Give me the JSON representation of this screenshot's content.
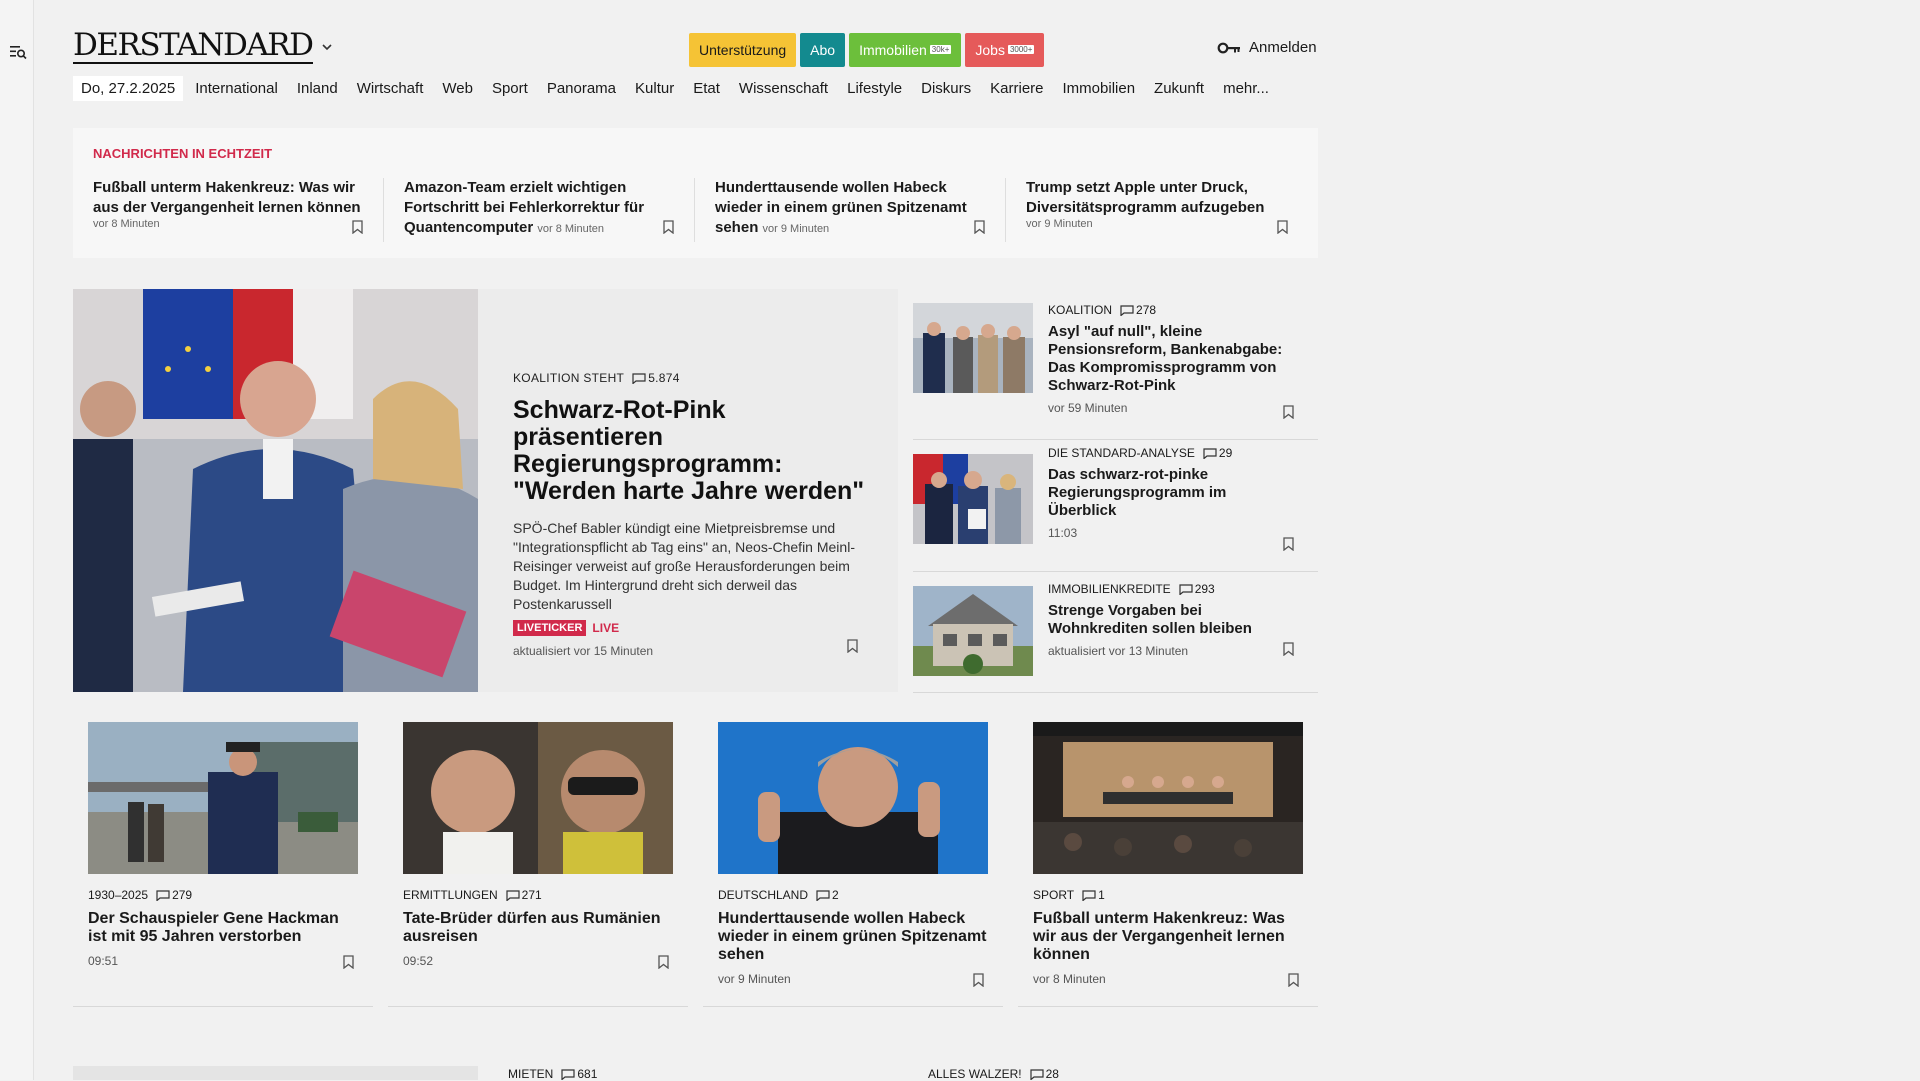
{
  "header": {
    "logo": "DERSTANDARD",
    "pills": {
      "unterstuetzung": "Unterstützung",
      "abo": "Abo",
      "immobilien": "Immobilien",
      "immobilien_badge": "30k+",
      "jobs": "Jobs",
      "jobs_badge": "3000+"
    },
    "login": "Anmelden"
  },
  "nav": {
    "date": "Do, 27.2.2025",
    "items": [
      "International",
      "Inland",
      "Wirtschaft",
      "Web",
      "Sport",
      "Panorama",
      "Kultur",
      "Etat",
      "Wissenschaft",
      "Lifestyle",
      "Diskurs",
      "Karriere",
      "Immobilien",
      "Zukunft",
      "mehr..."
    ]
  },
  "ticker": {
    "label": "NACHRICHTEN IN ECHTZEIT",
    "items": [
      {
        "title": "Fußball unterm Hakenkreuz: Was wir aus der Vergangenheit lernen können",
        "time": "vor 8 Minuten"
      },
      {
        "title": "Amazon-Team erzielt wichtigen Fortschritt bei Fehlerkorrektur für Quantencomputer",
        "time": "vor 8 Minuten"
      },
      {
        "title": "Hunderttausende wollen Habeck wieder in einem grünen Spitzenamt sehen",
        "time": "vor 9 Minuten"
      },
      {
        "title": "Trump setzt Apple unter Druck, Diversitätsprogramm aufzugeben",
        "time": "vor 9 Minuten"
      }
    ]
  },
  "hero": {
    "kicker": "KOALITION STEHT",
    "comments": "5.874",
    "title": "Schwarz-Rot-Pink präsentieren Regierungsprogramm: \"Werden harte Jahre werden\"",
    "lead": "SPÖ-Chef Babler kündigt eine Mietpreisbremse und \"Integrationspflicht ab Tag eins\" an, Neos-Chefin Meinl-Reisinger verweist auf große Herausforderungen beim Budget. Im Hintergrund dreht sich derweil das Postenkarussell",
    "badge": "LIVETICKER",
    "live": "LIVE",
    "updated": "aktualisiert vor 15 Minuten"
  },
  "side": [
    {
      "kicker": "KOALITION",
      "comments": "278",
      "title": "Asyl \"auf null\", kleine Pensionsreform, Bankenabgabe: Das Kompromissprogramm von Schwarz-Rot-Pink",
      "time": "vor 59 Minuten"
    },
    {
      "kicker": "DIE STANDARD-ANALYSE",
      "comments": "29",
      "title": "Das schwarz-rot-pinke Regierungsprogramm im Überblick",
      "time": "11:03"
    },
    {
      "kicker": "IMMOBILIENKREDITE",
      "comments": "293",
      "title": "Strenge Vorgaben bei Wohnkrediten sollen bleiben",
      "time": "aktualisiert vor 13 Minuten"
    }
  ],
  "grid": [
    {
      "kicker": "1930–2025",
      "comments": "279",
      "title": "Der Schauspieler Gene Hackman ist mit 95 Jahren verstorben",
      "time": "09:51"
    },
    {
      "kicker": "ERMITTLUNGEN",
      "comments": "271",
      "title": "Tate-Brüder dürfen aus Rumänien ausreisen",
      "time": "09:52"
    },
    {
      "kicker": "DEUTSCHLAND",
      "comments": "2",
      "title": "Hunderttausende wollen Habeck wieder in einem grünen Spitzenamt sehen",
      "time": "vor 9 Minuten"
    },
    {
      "kicker": "SPORT",
      "comments": "1",
      "title": "Fußball unterm Hakenkreuz: Was wir aus der Vergangenheit lernen können",
      "time": "vor 8 Minuten"
    }
  ],
  "bottom": [
    {
      "kicker": "MIETEN",
      "comments": "681"
    },
    {
      "kicker": "ALLES WALZER!",
      "comments": "28"
    }
  ]
}
